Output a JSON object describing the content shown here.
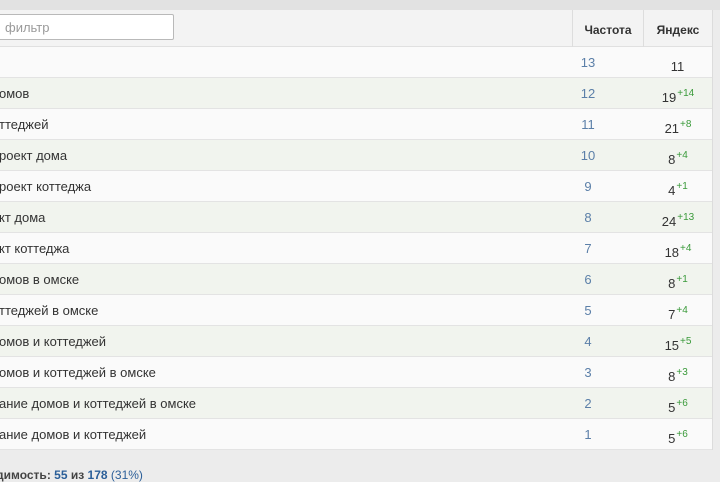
{
  "filter": {
    "placeholder": "фильтр"
  },
  "headers": {
    "frequency": "Частота",
    "yandex": "Яндекс"
  },
  "rows": [
    {
      "phrase": "",
      "frequency": "13",
      "yandex": "11",
      "delta": ""
    },
    {
      "phrase": "омов",
      "frequency": "12",
      "yandex": "19",
      "delta": "+14"
    },
    {
      "phrase": "ттеджей",
      "frequency": "11",
      "yandex": "21",
      "delta": "+8"
    },
    {
      "phrase": "роект дома",
      "frequency": "10",
      "yandex": "8",
      "delta": "+4"
    },
    {
      "phrase": "роект коттеджа",
      "frequency": "9",
      "yandex": "4",
      "delta": "+1"
    },
    {
      "phrase": "кт дома",
      "frequency": "8",
      "yandex": "24",
      "delta": "+13"
    },
    {
      "phrase": "кт коттеджа",
      "frequency": "7",
      "yandex": "18",
      "delta": "+4"
    },
    {
      "phrase": "омов в омске",
      "frequency": "6",
      "yandex": "8",
      "delta": "+1"
    },
    {
      "phrase": "ттеджей в омске",
      "frequency": "5",
      "yandex": "7",
      "delta": "+4"
    },
    {
      "phrase": "омов и коттеджей",
      "frequency": "4",
      "yandex": "15",
      "delta": "+5"
    },
    {
      "phrase": "омов и коттеджей в омске",
      "frequency": "3",
      "yandex": "8",
      "delta": "+3"
    },
    {
      "phrase": "ание домов и коттеджей в омске",
      "frequency": "2",
      "yandex": "5",
      "delta": "+6"
    },
    {
      "phrase": "ание домов и коттеджей",
      "frequency": "1",
      "yandex": "5",
      "delta": "+6"
    }
  ],
  "footer": {
    "label": "димость:",
    "found": "55",
    "of_word": "из",
    "total": "178",
    "percent": "(31%)"
  }
}
